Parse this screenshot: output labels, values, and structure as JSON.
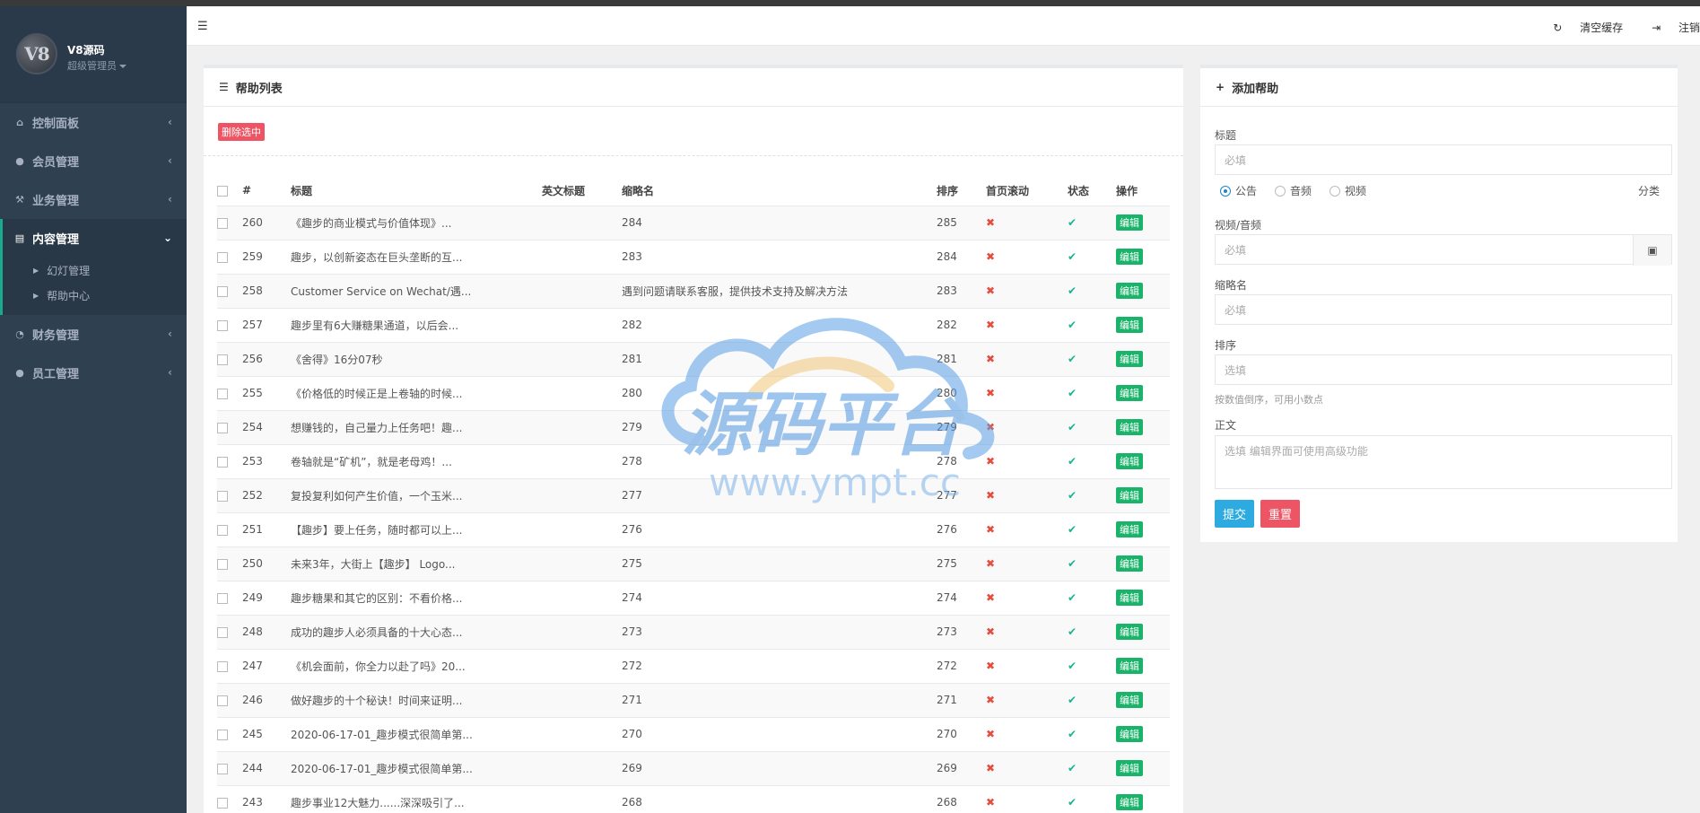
{
  "sidebar": {
    "profile": {
      "avatar_text": "V8",
      "name": "V8源码",
      "role": "超级管理员"
    },
    "groups": [
      {
        "label": "控制面板",
        "icon": "home-icon"
      },
      {
        "label": "会员管理",
        "icon": "user-icon"
      },
      {
        "label": "业务管理",
        "icon": "gavel-icon"
      },
      {
        "label": "内容管理",
        "icon": "book-icon",
        "active": true,
        "children": [
          "幻灯管理",
          "帮助中心"
        ]
      },
      {
        "label": "财务管理",
        "icon": "pie-chart-icon"
      },
      {
        "label": "员工管理",
        "icon": "user-tie-icon"
      }
    ]
  },
  "topbar": {
    "clear_cache": "清空缓存",
    "logout": "注销"
  },
  "list": {
    "title": "帮助列表",
    "delete_selected": "删除选中",
    "columns": [
      "#",
      "标题",
      "英文标题",
      "缩略名",
      "排序",
      "首页滚动",
      "状态",
      "操作"
    ],
    "edit_label": "编辑",
    "rows": [
      {
        "id": "260",
        "title": "《趣步的商业模式与价值体现》...",
        "en": "",
        "slug": "284",
        "sort": "285",
        "scroll": "x",
        "status": "ok"
      },
      {
        "id": "259",
        "title": "趣步，以创新姿态在巨头垄断的互...",
        "en": "",
        "slug": "283",
        "sort": "284",
        "scroll": "x",
        "status": "ok"
      },
      {
        "id": "258",
        "title": "Customer Service on Wechat/遇...",
        "en": "",
        "slug": "遇到问题请联系客服，提供技术支持及解决方法",
        "sort": "283",
        "scroll": "x",
        "status": "ok"
      },
      {
        "id": "257",
        "title": "趣步里有6大赚糖果通道，以后会...",
        "en": "",
        "slug": "282",
        "sort": "282",
        "scroll": "x",
        "status": "ok"
      },
      {
        "id": "256",
        "title": "《舍得》16分07秒",
        "en": "",
        "slug": "281",
        "sort": "281",
        "scroll": "x",
        "status": "ok"
      },
      {
        "id": "255",
        "title": "《价格低的时候正是上卷轴的时候...",
        "en": "",
        "slug": "280",
        "sort": "280",
        "scroll": "x",
        "status": "ok"
      },
      {
        "id": "254",
        "title": "想赚钱的，自己量力上任务吧！趣...",
        "en": "",
        "slug": "279",
        "sort": "279",
        "scroll": "x",
        "status": "ok"
      },
      {
        "id": "253",
        "title": "卷轴就是“矿机”，就是老母鸡！...",
        "en": "",
        "slug": "278",
        "sort": "278",
        "scroll": "x",
        "status": "ok"
      },
      {
        "id": "252",
        "title": "复投复利如何产生价值，一个玉米...",
        "en": "",
        "slug": "277",
        "sort": "277",
        "scroll": "x",
        "status": "ok"
      },
      {
        "id": "251",
        "title": "【趣步】要上任务，随时都可以上...",
        "en": "",
        "slug": "276",
        "sort": "276",
        "scroll": "x",
        "status": "ok"
      },
      {
        "id": "250",
        "title": "未来3年，大街上【趣步】 Logo...",
        "en": "",
        "slug": "275",
        "sort": "275",
        "scroll": "x",
        "status": "ok"
      },
      {
        "id": "249",
        "title": "趣步糖果和其它的区别：不看价格...",
        "en": "",
        "slug": "274",
        "sort": "274",
        "scroll": "x",
        "status": "ok"
      },
      {
        "id": "248",
        "title": "成功的趣步人必须具备的十大心态...",
        "en": "",
        "slug": "273",
        "sort": "273",
        "scroll": "x",
        "status": "ok"
      },
      {
        "id": "247",
        "title": "《机会面前，你全力以赴了吗》20...",
        "en": "",
        "slug": "272",
        "sort": "272",
        "scroll": "x",
        "status": "ok"
      },
      {
        "id": "246",
        "title": "做好趣步的十个秘诀！时间来证明...",
        "en": "",
        "slug": "271",
        "sort": "271",
        "scroll": "x",
        "status": "ok"
      },
      {
        "id": "245",
        "title": "2020-06-17-01_趣步模式很简单第...",
        "en": "",
        "slug": "270",
        "sort": "270",
        "scroll": "x",
        "status": "ok"
      },
      {
        "id": "244",
        "title": "2020-06-17-01_趣步模式很简单第...",
        "en": "",
        "slug": "269",
        "sort": "269",
        "scroll": "x",
        "status": "ok"
      },
      {
        "id": "243",
        "title": "趣步事业12大魅力......深深吸引了...",
        "en": "",
        "slug": "268",
        "sort": "268",
        "scroll": "x",
        "status": "ok"
      }
    ]
  },
  "form": {
    "title": "添加帮助",
    "title_label": "标题",
    "title_placeholder": "必填",
    "radio_options": [
      "公告",
      "音频",
      "视频"
    ],
    "radio_selected": "公告",
    "category_label": "分类",
    "media_label": "视频/音频",
    "media_placeholder": "必填",
    "slug_label": "缩略名",
    "slug_placeholder": "必填",
    "sort_label": "排序",
    "sort_placeholder": "选填",
    "sort_help": "按数值倒序，可用小数点",
    "body_label": "正文",
    "body_placeholder": "选填 编辑界面可使用高级功能",
    "submit": "提交",
    "reset": "重置"
  },
  "watermark": {
    "text_cn": "源码平台",
    "text_url": "www.ympt.cc"
  },
  "colors": {
    "sidebar": "#2f4050",
    "accent": "#19aa8d",
    "danger": "#ed5565",
    "success": "#1ab36a",
    "primary": "#2dabe0"
  }
}
